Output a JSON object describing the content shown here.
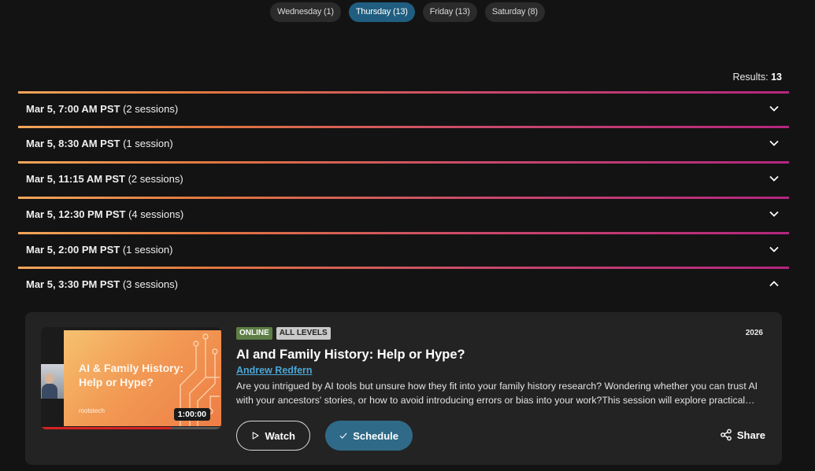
{
  "day_tabs": [
    {
      "label": "Wednesday (1)",
      "active": false
    },
    {
      "label": "Thursday (13)",
      "active": true
    },
    {
      "label": "Friday (13)",
      "active": false
    },
    {
      "label": "Saturday (8)",
      "active": false
    }
  ],
  "results": {
    "label": "Results:",
    "count": "13"
  },
  "slots": [
    {
      "time": "Mar 5, 7:00 AM PST",
      "sessions": "(2 sessions)",
      "expanded": false
    },
    {
      "time": "Mar 5, 8:30 AM PST",
      "sessions": "(1 session)",
      "expanded": false
    },
    {
      "time": "Mar 5, 11:15 AM PST",
      "sessions": "(2 sessions)",
      "expanded": false
    },
    {
      "time": "Mar 5, 12:30 PM PST",
      "sessions": "(4 sessions)",
      "expanded": false
    },
    {
      "time": "Mar 5, 2:00 PM PST",
      "sessions": "(1 session)",
      "expanded": false
    },
    {
      "time": "Mar 5, 3:30 PM PST",
      "sessions": "(3 sessions)",
      "expanded": true
    }
  ],
  "session": {
    "thumbnail": {
      "slide_title": "AI & Family History: Help or Hype?",
      "brand": "rootstech",
      "duration": "1:00:00",
      "watched_fraction": 0.72
    },
    "badges": {
      "online": "ONLINE",
      "level": "ALL LEVELS"
    },
    "year": "2026",
    "title": "AI and Family History: Help or Hype?",
    "speaker": "Andrew Redfern",
    "description": "Are you intrigued by AI tools but unsure how they fit into your family history research? Wondering whether you can trust AI with your ancestors' stories, or how to avoid introducing errors or bias into your work?This session will explore practical ways to use AI in your genealogy.",
    "watch_label": "Watch",
    "schedule_label": "Schedule",
    "share_label": "Share"
  },
  "colors": {
    "background": "#141313",
    "active_tab": "#1f5e80",
    "divider_gradient_start": "#f2a65a",
    "divider_gradient_end": "#b3267f",
    "link": "#4aa6d6",
    "schedule_button": "#2f6b89",
    "online_badge": "#5d7f45"
  },
  "icons": {
    "collapsed": "chevron-down-icon",
    "expanded": "chevron-up-icon",
    "watch": "play-icon",
    "schedule": "check-icon",
    "share": "share-icon"
  }
}
